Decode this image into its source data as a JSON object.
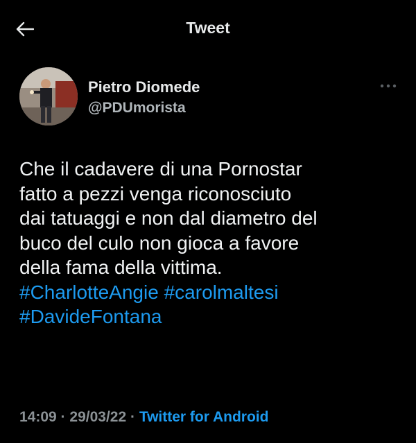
{
  "header": {
    "title": "Tweet",
    "back_icon": "arrow-left-icon"
  },
  "author": {
    "display_name": "Pietro Diomede",
    "handle": "@PDUmorista",
    "avatar": "avatar-photo",
    "more_icon": "more-horizontal-icon"
  },
  "tweet": {
    "lines": [
      "Che il cadavere di una Pornostar",
      "fatto a pezzi venga riconosciuto",
      "dai tatuaggi e non dal diametro del",
      "buco del culo non gioca a favore",
      "della fama della vittima."
    ],
    "hashtags": [
      "#CharlotteAngie",
      "#carolmaltesi",
      "#DavideFontana"
    ]
  },
  "meta": {
    "time": "14:09",
    "separator": " · ",
    "date": "29/03/22",
    "source": "Twitter for Android"
  },
  "colors": {
    "background": "#000000",
    "link": "#1d9bf0",
    "secondary_text": "#8b9195"
  }
}
